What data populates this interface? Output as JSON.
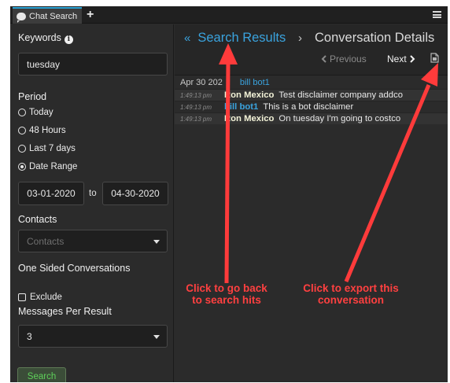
{
  "app": {
    "tab_label": "Chat Search",
    "add_tab_symbol": "+"
  },
  "sidebar": {
    "keywords_label": "Keywords",
    "info_symbol": "i",
    "keywords_value": "tuesday",
    "period_label": "Period",
    "period_options": [
      "Today",
      "48 Hours",
      "Last 7 days",
      "Date Range"
    ],
    "period_selected": "Date Range",
    "date_from": "03-01-2020",
    "date_to_word": "to",
    "date_to": "04-30-2020",
    "contacts_label": "Contacts",
    "contacts_placeholder": "Contacts",
    "one_sided_label": "One Sided Conversations",
    "exclude_label": "Exclude",
    "exclude_checked": false,
    "messages_per_result_label": "Messages Per Result",
    "messages_per_result_value": "3",
    "search_button": "Search"
  },
  "main": {
    "back_link": "Search Results",
    "back_chevron": "«",
    "breadcrumb_separator": "›",
    "current_page": "Conversation Details",
    "previous_label": "Previous",
    "next_label": "Next",
    "results": {
      "date": "Apr 30 202",
      "group_name": "bill bot1",
      "messages": [
        {
          "time": "1:49:13 pm",
          "sender": "Ron Mexico",
          "type": "user",
          "text": "Test disclaimer company addco"
        },
        {
          "time": "1:49:13 pm",
          "sender": "bill bot1",
          "type": "bot",
          "text": "This is a bot disclaimer"
        },
        {
          "time": "1:49:13 pm",
          "sender": "Ron Mexico",
          "type": "user",
          "text": "On tuesday I'm going to costco"
        }
      ]
    }
  },
  "annotations": {
    "back_note_line1": "Click to go back",
    "back_note_line2": "to search hits",
    "export_note_line1": "Click to export this",
    "export_note_line2": "conversation"
  },
  "colors": {
    "accent_blue": "#3aa3de",
    "annotation_red": "#ff4040",
    "search_green": "#5ed05a"
  }
}
